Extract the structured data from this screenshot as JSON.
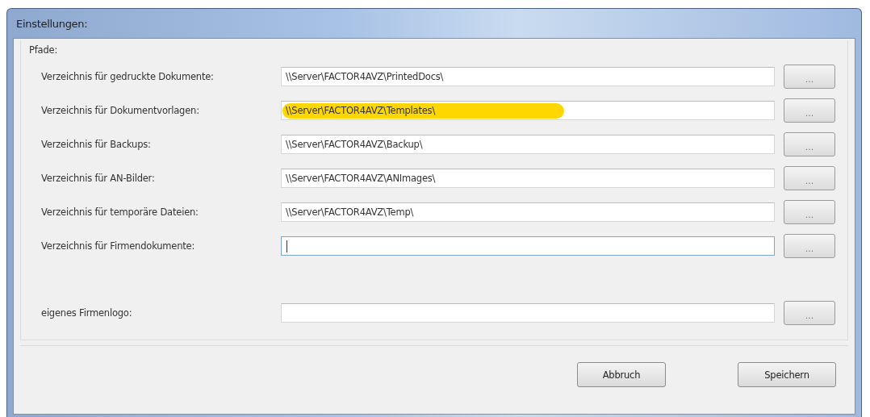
{
  "window": {
    "title": "Einstellungen:"
  },
  "group": {
    "title": "Pfade:"
  },
  "rows": [
    {
      "label": "Verzeichnis für gedruckte Dokumente:",
      "value": "\\\\Server\\FACTOR4AVZ\\PrintedDocs\\",
      "highlighted": false,
      "focused": false,
      "button": "..."
    },
    {
      "label": "Verzeichnis für Dokumentvorlagen:",
      "value": "\\\\Server\\FACTOR4AVZ\\Templates\\",
      "highlighted": true,
      "focused": false,
      "button": "..."
    },
    {
      "label": "Verzeichnis für Backups:",
      "value": "\\\\Server\\FACTOR4AVZ\\Backup\\",
      "highlighted": false,
      "focused": false,
      "button": "..."
    },
    {
      "label": "Verzeichnis für AN-Bilder:",
      "value": "\\\\Server\\FACTOR4AVZ\\ANImages\\",
      "highlighted": false,
      "focused": false,
      "button": "..."
    },
    {
      "label": "Verzeichnis für temporäre Dateien:",
      "value": "\\\\Server\\FACTOR4AVZ\\Temp\\",
      "highlighted": false,
      "focused": false,
      "button": "..."
    },
    {
      "label": "Verzeichnis für Firmendokumente:",
      "value": "",
      "highlighted": false,
      "focused": true,
      "button": "..."
    },
    {
      "label": "eigenes Firmenlogo:",
      "value": "",
      "highlighted": false,
      "focused": false,
      "button": "..."
    }
  ],
  "buttons": [
    "Abbruch",
    "Speichern"
  ]
}
